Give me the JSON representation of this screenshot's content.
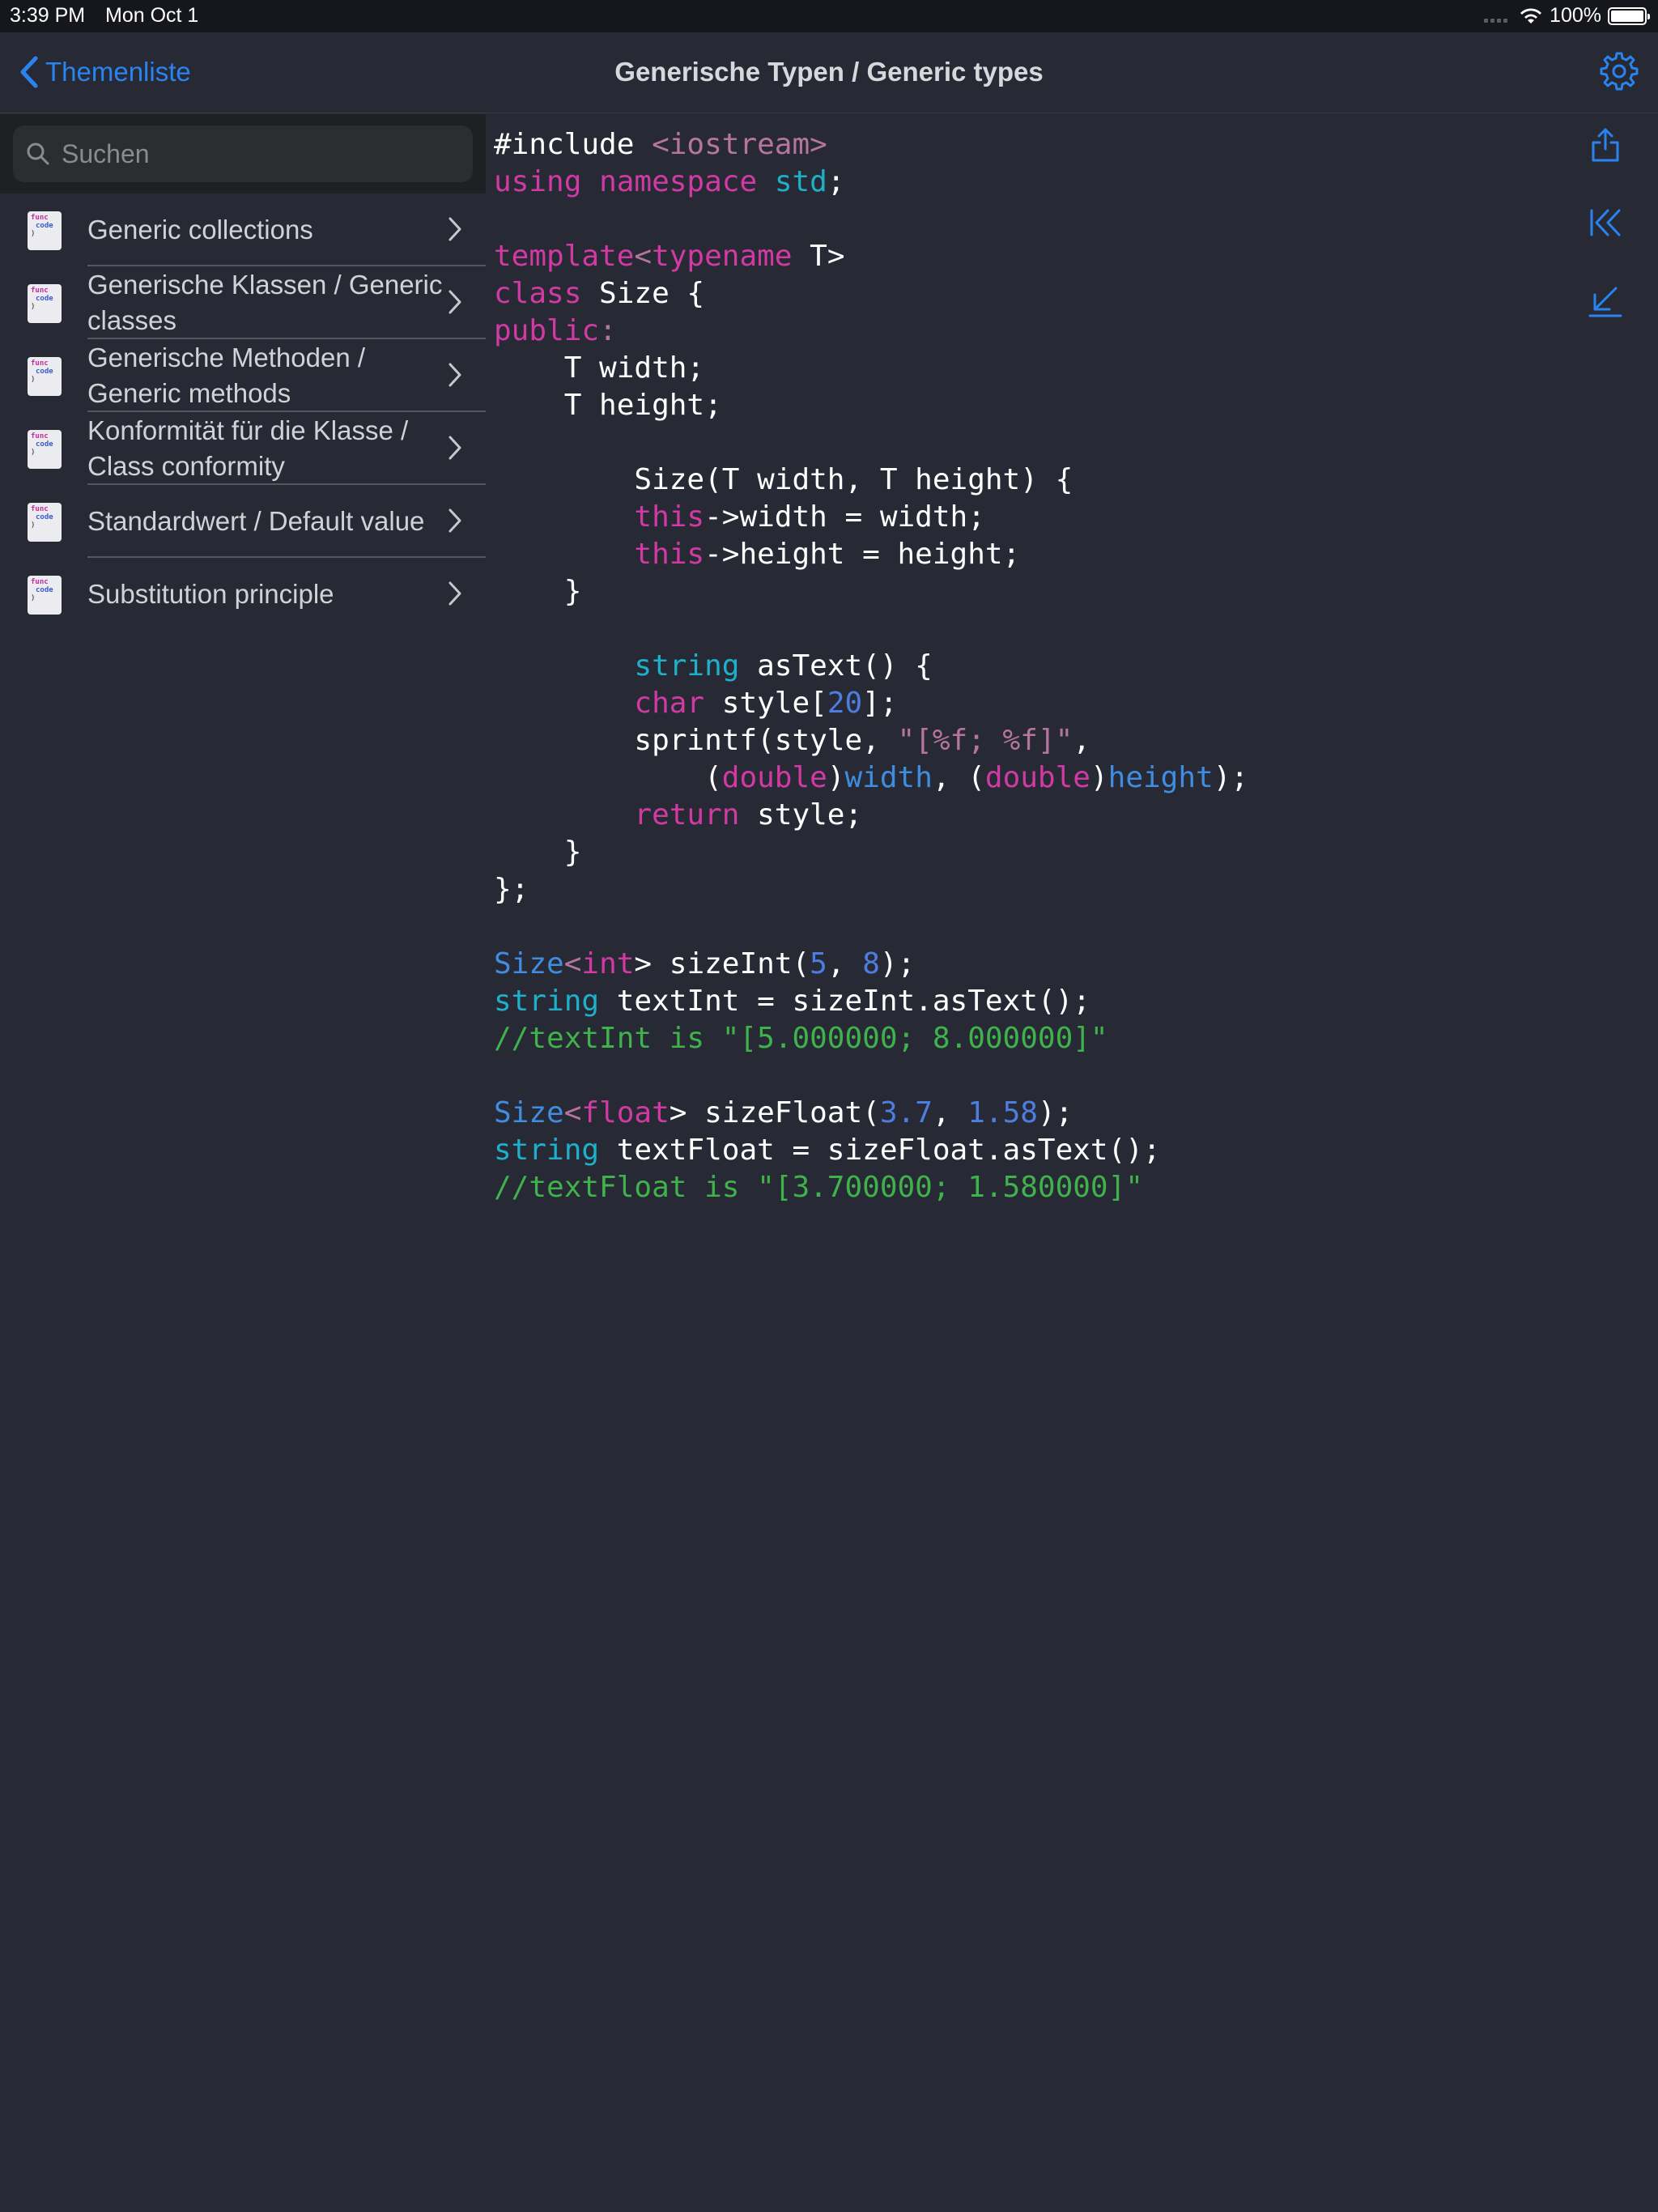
{
  "status_bar": {
    "time": "3:39 PM",
    "date": "Mon Oct 1",
    "battery": "100%"
  },
  "nav": {
    "back_label": "Themenliste",
    "title": "Generische Typen / Generic types"
  },
  "search": {
    "placeholder": "Suchen"
  },
  "sidebar": {
    "items": [
      {
        "label": "Generic collections"
      },
      {
        "label": "Generische Klassen / Generic classes"
      },
      {
        "label": "Generische Methoden / Generic methods"
      },
      {
        "label": "Konformität für die Klasse / Class conformity"
      },
      {
        "label": "Standardwert / Default value"
      },
      {
        "label": "Substitution principle"
      }
    ],
    "thumb_text": [
      "func",
      "code",
      ")"
    ]
  },
  "code_lines": [
    [
      [
        "w",
        "#include "
      ],
      [
        "s",
        "<iostream>"
      ]
    ],
    [
      [
        "k",
        "using"
      ],
      [
        "w",
        " "
      ],
      [
        "k",
        "namespace"
      ],
      [
        "w",
        " "
      ],
      [
        "t",
        "std"
      ],
      [
        "w",
        ";"
      ]
    ],
    [],
    [
      [
        "k",
        "template"
      ],
      [
        "s",
        "<"
      ],
      [
        "k",
        "typename"
      ],
      [
        "w",
        " T>"
      ]
    ],
    [
      [
        "k",
        "class"
      ],
      [
        "w",
        " Size {"
      ]
    ],
    [
      [
        "k",
        "public"
      ],
      [
        "s",
        ":"
      ]
    ],
    [
      [
        "w",
        "    T width;"
      ]
    ],
    [
      [
        "w",
        "    T height;"
      ]
    ],
    [],
    [
      [
        "w",
        "        Size(T width, T height) {"
      ]
    ],
    [
      [
        "w",
        "        "
      ],
      [
        "k",
        "this"
      ],
      [
        "w",
        "->width = width;"
      ]
    ],
    [
      [
        "w",
        "        "
      ],
      [
        "k",
        "this"
      ],
      [
        "w",
        "->height = height;"
      ]
    ],
    [
      [
        "w",
        "    }"
      ]
    ],
    [],
    [
      [
        "w",
        "        "
      ],
      [
        "t",
        "string"
      ],
      [
        "w",
        " asText() {"
      ]
    ],
    [
      [
        "w",
        "        "
      ],
      [
        "k",
        "char"
      ],
      [
        "w",
        " style["
      ],
      [
        "n",
        "20"
      ],
      [
        "w",
        "];"
      ]
    ],
    [
      [
        "w",
        "        sprintf(style, "
      ],
      [
        "s",
        "\"[%f; %f]\""
      ],
      [
        "w",
        ","
      ]
    ],
    [
      [
        "w",
        "            ("
      ],
      [
        "k",
        "double"
      ],
      [
        "w",
        ")"
      ],
      [
        "f",
        "width"
      ],
      [
        "w",
        ", ("
      ],
      [
        "k",
        "double"
      ],
      [
        "w",
        ")"
      ],
      [
        "f",
        "height"
      ],
      [
        "w",
        ");"
      ]
    ],
    [
      [
        "w",
        "        "
      ],
      [
        "k",
        "return"
      ],
      [
        "w",
        " style;"
      ]
    ],
    [
      [
        "w",
        "    }"
      ]
    ],
    [
      [
        "w",
        "};"
      ]
    ],
    [],
    [
      [
        "f",
        "Size"
      ],
      [
        "s",
        "<"
      ],
      [
        "k",
        "int"
      ],
      [
        "w",
        "> sizeInt("
      ],
      [
        "n",
        "5"
      ],
      [
        "w",
        ", "
      ],
      [
        "n",
        "8"
      ],
      [
        "w",
        ");"
      ]
    ],
    [
      [
        "t",
        "string"
      ],
      [
        "w",
        " textInt = sizeInt.asText();"
      ]
    ],
    [
      [
        "c",
        "//textInt is \"[5.000000; 8.000000]\""
      ]
    ],
    [],
    [
      [
        "f",
        "Size"
      ],
      [
        "s",
        "<"
      ],
      [
        "k",
        "float"
      ],
      [
        "w",
        "> sizeFloat("
      ],
      [
        "n",
        "3.7"
      ],
      [
        "w",
        ", "
      ],
      [
        "n",
        "1.58"
      ],
      [
        "w",
        ");"
      ]
    ],
    [
      [
        "t",
        "string"
      ],
      [
        "w",
        " textFloat = sizeFloat.asText();"
      ]
    ],
    [
      [
        "c",
        "//textFloat is \"[3.700000; 1.580000]\""
      ]
    ]
  ],
  "colors": {
    "accent": "#2a84f0",
    "background": "#272a35",
    "keyword": "#d13aa3",
    "type": "#1fb0c9",
    "number": "#4d7de0",
    "comment": "#3fb24b"
  },
  "icons": [
    "chevron-left-icon",
    "gear-icon",
    "search-icon",
    "share-icon",
    "skip-to-start-icon",
    "arrow-down-left-icon",
    "chevron-right-icon"
  ]
}
